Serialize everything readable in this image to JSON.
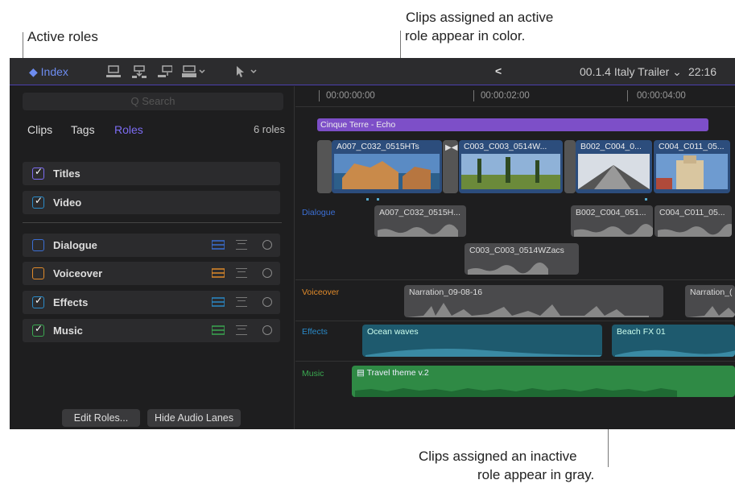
{
  "callouts": {
    "active_roles": "Active roles",
    "active_clips_line1": "Clips assigned an active",
    "active_clips_line2": "role appear in color.",
    "inactive_clips_line1": "Clips assigned an inactive",
    "inactive_clips_line2": "role appear in gray."
  },
  "toolbar": {
    "index_label": "Index",
    "index_icon": "diamond-icon",
    "back_icon": "<",
    "project_title": "00.1.4 Italy Trailer ⌄",
    "timecode": "22:16"
  },
  "sidebar": {
    "search_placeholder": "Q Search",
    "tabs": [
      "Clips",
      "Tags",
      "Roles"
    ],
    "active_tab": "Roles",
    "role_count": "6 roles",
    "video_roles": [
      {
        "label": "Titles",
        "checked": true
      },
      {
        "label": "Video",
        "checked": true
      }
    ],
    "audio_roles": [
      {
        "label": "Dialogue",
        "checked": false,
        "color": "#3b6fd4"
      },
      {
        "label": "Voiceover",
        "checked": false,
        "color": "#e08a2a"
      },
      {
        "label": "Effects",
        "checked": true,
        "color": "#2a8ac8"
      },
      {
        "label": "Music",
        "checked": true,
        "color": "#3aa850"
      }
    ],
    "buttons": {
      "edit_roles": "Edit Roles...",
      "hide_audio_lanes": "Hide Audio Lanes"
    }
  },
  "timeline": {
    "timecodes": [
      "00:00:00:00",
      "00:00:02:00",
      "00:00:04:00"
    ],
    "title_clip": "Cinque Terre - Echo",
    "video_clips": [
      "A007_C032_0515HTs",
      "C003_C003_0514W...",
      "B002_C004_0...",
      "C004_C011_05..."
    ],
    "lanes": {
      "dialogue": "Dialogue",
      "voiceover": "Voiceover",
      "effects": "Effects",
      "music": "Music"
    },
    "dialogue_clips": [
      "A007_C032_0515H...",
      "B002_C004_051...",
      "C004_C011_05...",
      "C003_C003_0514WZacs"
    ],
    "voiceover_clips": [
      "Narration_09-08-16",
      "Narration_("
    ],
    "effects_clips": [
      "Ocean waves",
      "Beach FX 01"
    ],
    "music_clip": "Travel theme v.2",
    "colors": {
      "title": "#7d4fc8",
      "video": "#2c4d7c",
      "inactive": "#4a4a4c",
      "effects": "#1e5a6e",
      "music": "#2f8a45",
      "accent": "#7c6cf2"
    }
  }
}
